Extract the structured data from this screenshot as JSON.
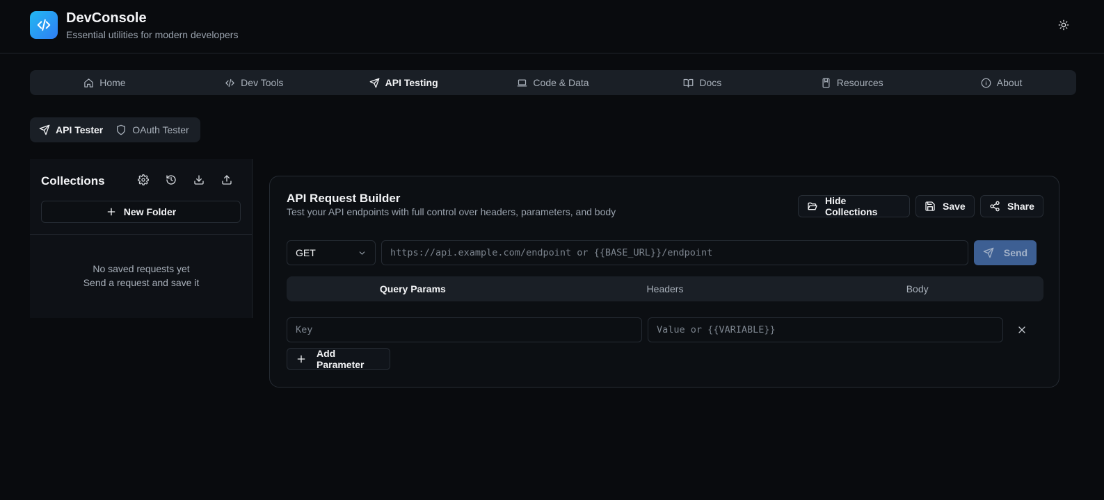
{
  "app": {
    "title": "DevConsole",
    "subtitle": "Essential utilities for modern developers"
  },
  "nav": {
    "items": [
      {
        "label": "Home",
        "icon": "home-icon"
      },
      {
        "label": "Dev Tools",
        "icon": "code-icon"
      },
      {
        "label": "API Testing",
        "icon": "send-icon",
        "active": true
      },
      {
        "label": "Code & Data",
        "icon": "laptop-icon"
      },
      {
        "label": "Docs",
        "icon": "book-open-icon"
      },
      {
        "label": "Resources",
        "icon": "bookmark-book-icon"
      },
      {
        "label": "About",
        "icon": "info-icon"
      }
    ]
  },
  "subtabs": [
    {
      "label": "API Tester",
      "icon": "send-icon",
      "active": true
    },
    {
      "label": "OAuth Tester",
      "icon": "shield-icon"
    }
  ],
  "collections": {
    "title": "Collections",
    "tools": [
      "settings-icon",
      "history-icon",
      "download-icon",
      "upload-icon"
    ],
    "new_folder_label": "New Folder",
    "empty_line1": "No saved requests yet",
    "empty_line2": "Send a request and save it"
  },
  "builder": {
    "title": "API Request Builder",
    "subtitle": "Test your API endpoints with full control over headers, parameters, and body",
    "hide_collections_label": "Hide Collections",
    "save_label": "Save",
    "share_label": "Share",
    "method": "GET",
    "url_value": "",
    "url_placeholder": "https://api.example.com/endpoint or {{BASE_URL}}/endpoint",
    "send_label": "Send",
    "tabs": [
      {
        "label": "Query Params",
        "active": true
      },
      {
        "label": "Headers"
      },
      {
        "label": "Body"
      }
    ],
    "params": {
      "key_placeholder": "Key",
      "value_placeholder": "Value or {{VARIABLE}}"
    },
    "add_param_label": "Add Parameter"
  },
  "colors": {
    "background": "#090b0e",
    "surface": "#1a1f26",
    "send_button": "#3d5f93",
    "logo_gradient_start": "#22b8f0",
    "logo_gradient_end": "#2f7ef5"
  }
}
